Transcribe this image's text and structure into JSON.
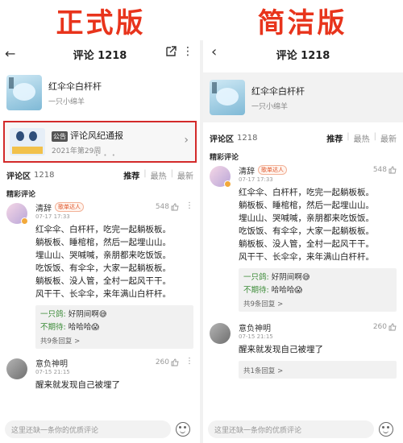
{
  "headers": {
    "left": "正式版",
    "right": "简洁版"
  },
  "left": {
    "nav": {
      "title": "评论 1218"
    },
    "song": {
      "name": "红伞伞白杆杆",
      "artist": "一只小绵羊"
    },
    "notice": {
      "badge": "公告",
      "title": "评论风纪通报",
      "issue": "2021年第29周",
      "dots": "• • •"
    },
    "tabs": {
      "zone": "评论区",
      "count": "1218",
      "sort_recommend": "推荐",
      "sort_hot": "最热",
      "sort_new": "最新",
      "sep": "|"
    },
    "section": "精彩评论",
    "comment1": {
      "user": "清辞",
      "badge": "歌单达人",
      "time": "07-17 17:33",
      "likes": "548",
      "lines": [
        "红伞伞、白杆杆，吃完一起躺板板。",
        "躺板板、睡棺棺，然后一起埋山山。",
        "埋山山、哭喊喊，亲朋都来吃饭饭。",
        "吃饭饭、有伞伞，大家一起躺板板。",
        "躺板板、没人管，全村一起风干干。",
        "风干干、长伞伞，来年满山白杆杆。"
      ],
      "reply1_user": "一只鸽:",
      "reply1_text": " 好阴间啊😅",
      "reply2_user": "不期待:",
      "reply2_text": " 哈哈哈😱",
      "reply_count": "共9条回复 >"
    },
    "comment2": {
      "user": "意负神明",
      "time": "07-15 21:15",
      "likes": "260",
      "text": "醒来就发现自己被埋了"
    },
    "input_placeholder": "这里还缺一条你的优质评论"
  },
  "right": {
    "nav": {
      "title": "评论 1218"
    },
    "song": {
      "name": "红伞伞白杆杆",
      "artist": "一只小绵羊"
    },
    "tabs": {
      "zone": "评论区",
      "count": "1218",
      "sort_recommend": "推荐",
      "sort_hot": "最热",
      "sort_new": "最新",
      "sep": "|"
    },
    "section": "精彩评论",
    "comment1": {
      "user": "清辞",
      "badge": "歌单达人",
      "time": "07-17 17:33",
      "likes": "548",
      "lines": [
        "红伞伞、白杆杆，吃完一起躺板板。",
        "躺板板、睡棺棺，然后一起埋山山。",
        "埋山山、哭喊喊，亲朋都来吃饭饭。",
        "吃饭饭、有伞伞，大家一起躺板板。",
        "躺板板、没人管，全村一起风干干。",
        "风干干、长伞伞，来年满山白杆杆。"
      ],
      "reply1_user": "一只鸽:",
      "reply1_text": " 好阴间啊😅",
      "reply2_user": "不期待:",
      "reply2_text": " 哈哈哈😱",
      "reply_count": "共9条回复 >"
    },
    "comment2": {
      "user": "意负神明",
      "time": "07-15 21:15",
      "likes": "260",
      "text": "醒来就发现自己被埋了",
      "reply_count": "共1条回复 >"
    },
    "input_placeholder": "这里还缺一条你的优质评论"
  }
}
